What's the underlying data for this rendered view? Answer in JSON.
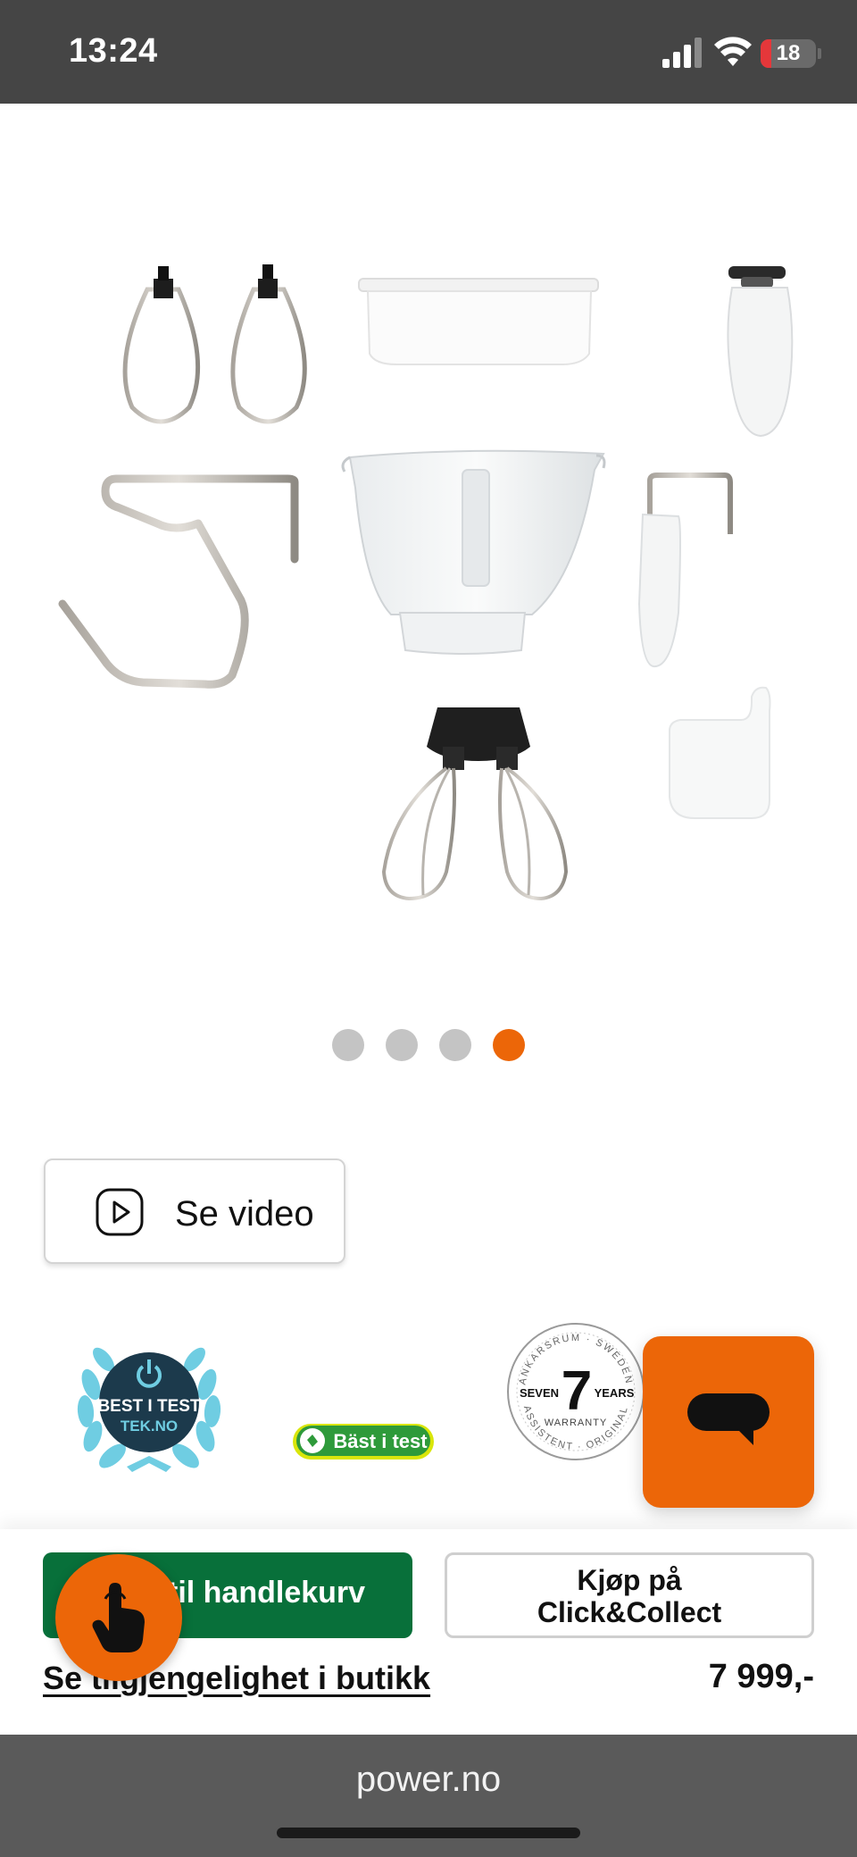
{
  "status_bar": {
    "time": "13:24",
    "battery_level": "18",
    "signal_icon": "cellular-signal-icon",
    "wifi_icon": "wifi-icon",
    "battery_icon": "battery-low-icon"
  },
  "gallery": {
    "image_alt": "mixer-accessories",
    "slide_count": 4,
    "active_slide": 4
  },
  "video_button": {
    "icon": "play-icon",
    "label": "Se video"
  },
  "badges": {
    "tek": {
      "line1": "BEST I TEST",
      "line2": "TEK.NO"
    },
    "bast": {
      "label": "Bäst i test"
    },
    "seven": {
      "number": "7",
      "left": "SEVEN",
      "right": "YEARS",
      "middle": "WARRANTY",
      "top_arc": "ANKARSRUM · SWEDEN",
      "bottom_arc": "ASSISTENT · ORIGINAL"
    }
  },
  "chat": {
    "icon": "chat-bubble-icon"
  },
  "purchase": {
    "add_to_cart_label": "til handlekurv",
    "click_collect_line1": "Kjøp på",
    "click_collect_line2": "Click&Collect",
    "availability_link": "Se tilgjengelighet i butikk",
    "price": "7 999,-"
  },
  "touch_button": {
    "icon": "touch-hand-icon"
  },
  "browser": {
    "url": "power.no"
  },
  "colors": {
    "accent": "#ec6608",
    "cart_green": "#08703a",
    "status_bar": "#454545",
    "browser_bar": "#5a5a5a"
  }
}
